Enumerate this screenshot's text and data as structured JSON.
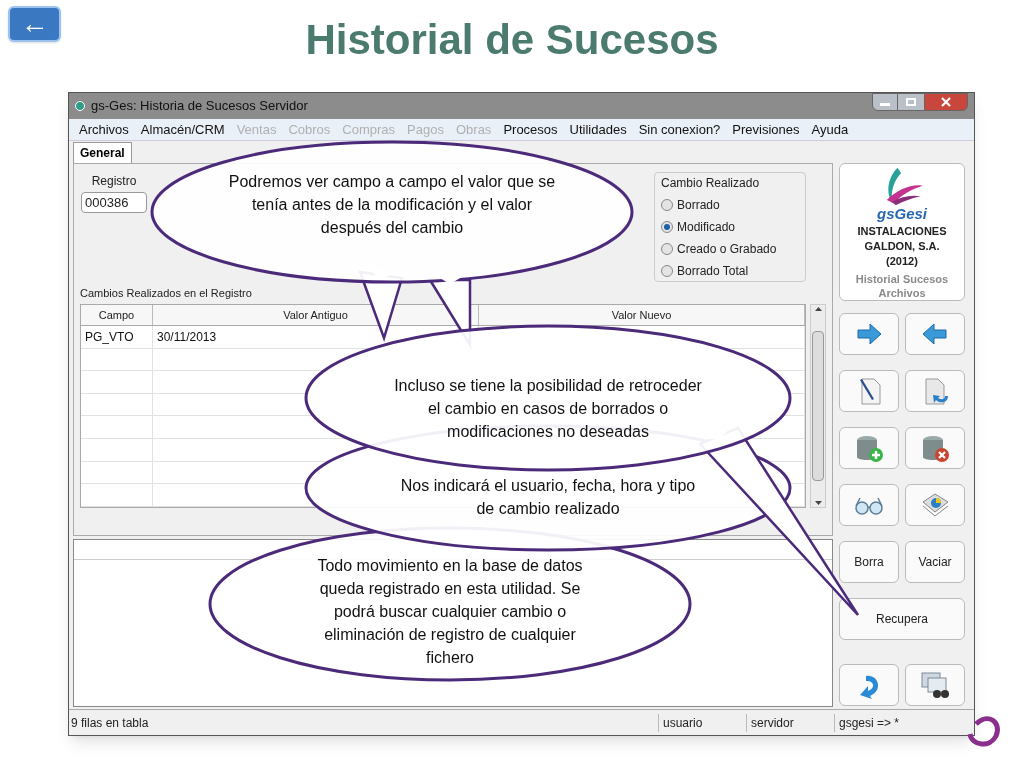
{
  "slide": {
    "title": "Historial de Sucesos",
    "back_button": "←"
  },
  "window": {
    "title": "gs-Ges: Historia de Sucesos Servidor"
  },
  "menu": [
    {
      "label": "Archivos",
      "disabled": false
    },
    {
      "label": "Almacén/CRM",
      "disabled": false
    },
    {
      "label": "Ventas",
      "disabled": true
    },
    {
      "label": "Cobros",
      "disabled": true
    },
    {
      "label": "Compras",
      "disabled": true
    },
    {
      "label": "Pagos",
      "disabled": true
    },
    {
      "label": "Obras",
      "disabled": true
    },
    {
      "label": "Procesos",
      "disabled": false
    },
    {
      "label": "Utilidades",
      "disabled": false
    },
    {
      "label": "Sin conexion?",
      "disabled": false
    },
    {
      "label": "Previsiones",
      "disabled": false
    },
    {
      "label": "Ayuda",
      "disabled": false
    }
  ],
  "tabs": [
    {
      "label": "General",
      "selected": true
    }
  ],
  "registro": {
    "label": "Registro",
    "value": "000386"
  },
  "cambio_realizado": {
    "title": "Cambio Realizado",
    "options": [
      {
        "label": "Borrado",
        "selected": false
      },
      {
        "label": "Modificado",
        "selected": true
      },
      {
        "label": "Creado o Grabado",
        "selected": false
      },
      {
        "label": "Borrado Total",
        "selected": false
      }
    ]
  },
  "company_panel": {
    "brand": "gsGesi",
    "lines": [
      "INSTALACIONES",
      "GALDON, S.A.",
      "(2012)"
    ],
    "caption": "Historial Sucesos Archivos"
  },
  "changes_table": {
    "title": "Cambios Realizados en el Registro",
    "columns": [
      "Campo",
      "Valor Antiguo",
      "Valor Nuevo"
    ],
    "rows": [
      [
        "PG_VTO",
        "30/11/2013"
      ]
    ]
  },
  "text_buttons": [
    "Borra",
    "Vaciar",
    "Recupera"
  ],
  "status_bar": [
    "9 filas en tabla",
    "usuario",
    "servidor",
    "gsgesi => *"
  ],
  "callouts": [
    {
      "text": "Podremos ver campo a campo el valor que se tenía antes de la modificación y el valor después del cambio"
    },
    {
      "text": "Incluso se tiene la posibilidad de retroceder el cambio en casos de borrados o modificaciones no deseadas"
    },
    {
      "text": "Nos indicará el usuario, fecha, hora y tipo de cambio realizado"
    },
    {
      "text": "Todo movimiento en la base de datos queda registrado en esta utilidad. Se podrá buscar cualquier cambio o eliminación de registro de cualquier fichero"
    }
  ]
}
